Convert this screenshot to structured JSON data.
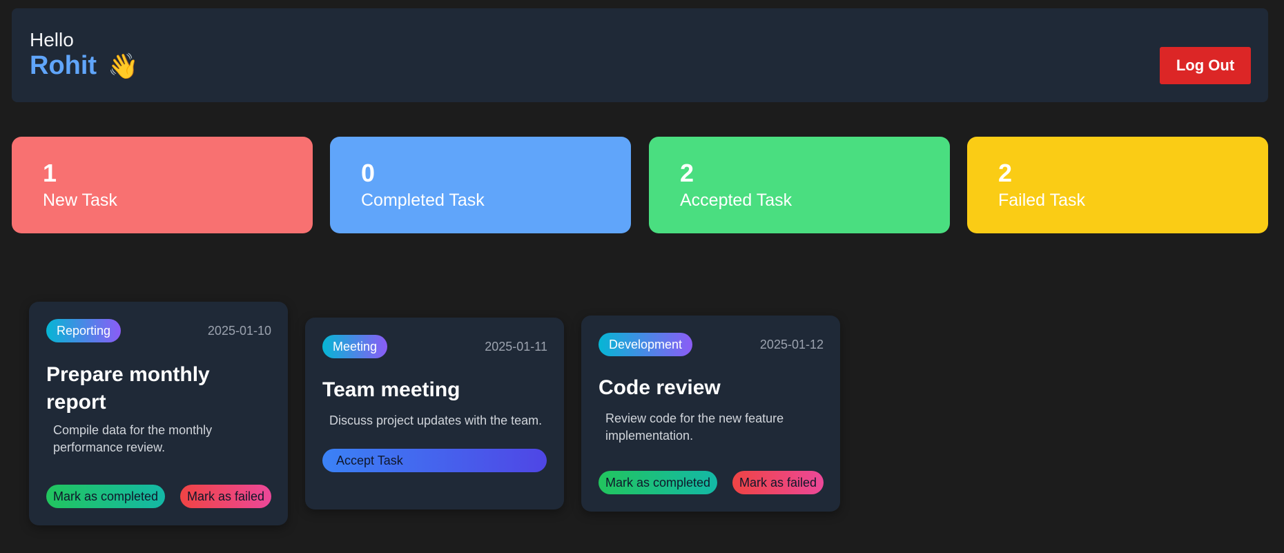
{
  "header": {
    "greeting": "Hello",
    "user_name": "Rohit",
    "wave_emoji": "👋",
    "logout_label": "Log Out"
  },
  "stats": [
    {
      "count": "1",
      "label": "New Task",
      "color": "#f87171"
    },
    {
      "count": "0",
      "label": "Completed Task",
      "color": "#60a5fa"
    },
    {
      "count": "2",
      "label": "Accepted Task",
      "color": "#4ade80"
    },
    {
      "count": "2",
      "label": "Failed Task",
      "color": "#facc15"
    }
  ],
  "tasks": [
    {
      "category": "Reporting",
      "date": "2025-01-10",
      "title": "Prepare monthly report",
      "description": "Compile data for the monthly performance review.",
      "completed_label": "Mark as completed",
      "failed_label": "Mark as failed"
    },
    {
      "category": "Meeting",
      "date": "2025-01-11",
      "title": "Team meeting",
      "description": "Discuss project updates with the team.",
      "accept_label": "Accept Task"
    },
    {
      "category": "Development",
      "date": "2025-01-12",
      "title": "Code review",
      "description": "Review code for the new feature implementation.",
      "completed_label": "Mark as completed",
      "failed_label": "Mark as failed"
    }
  ]
}
